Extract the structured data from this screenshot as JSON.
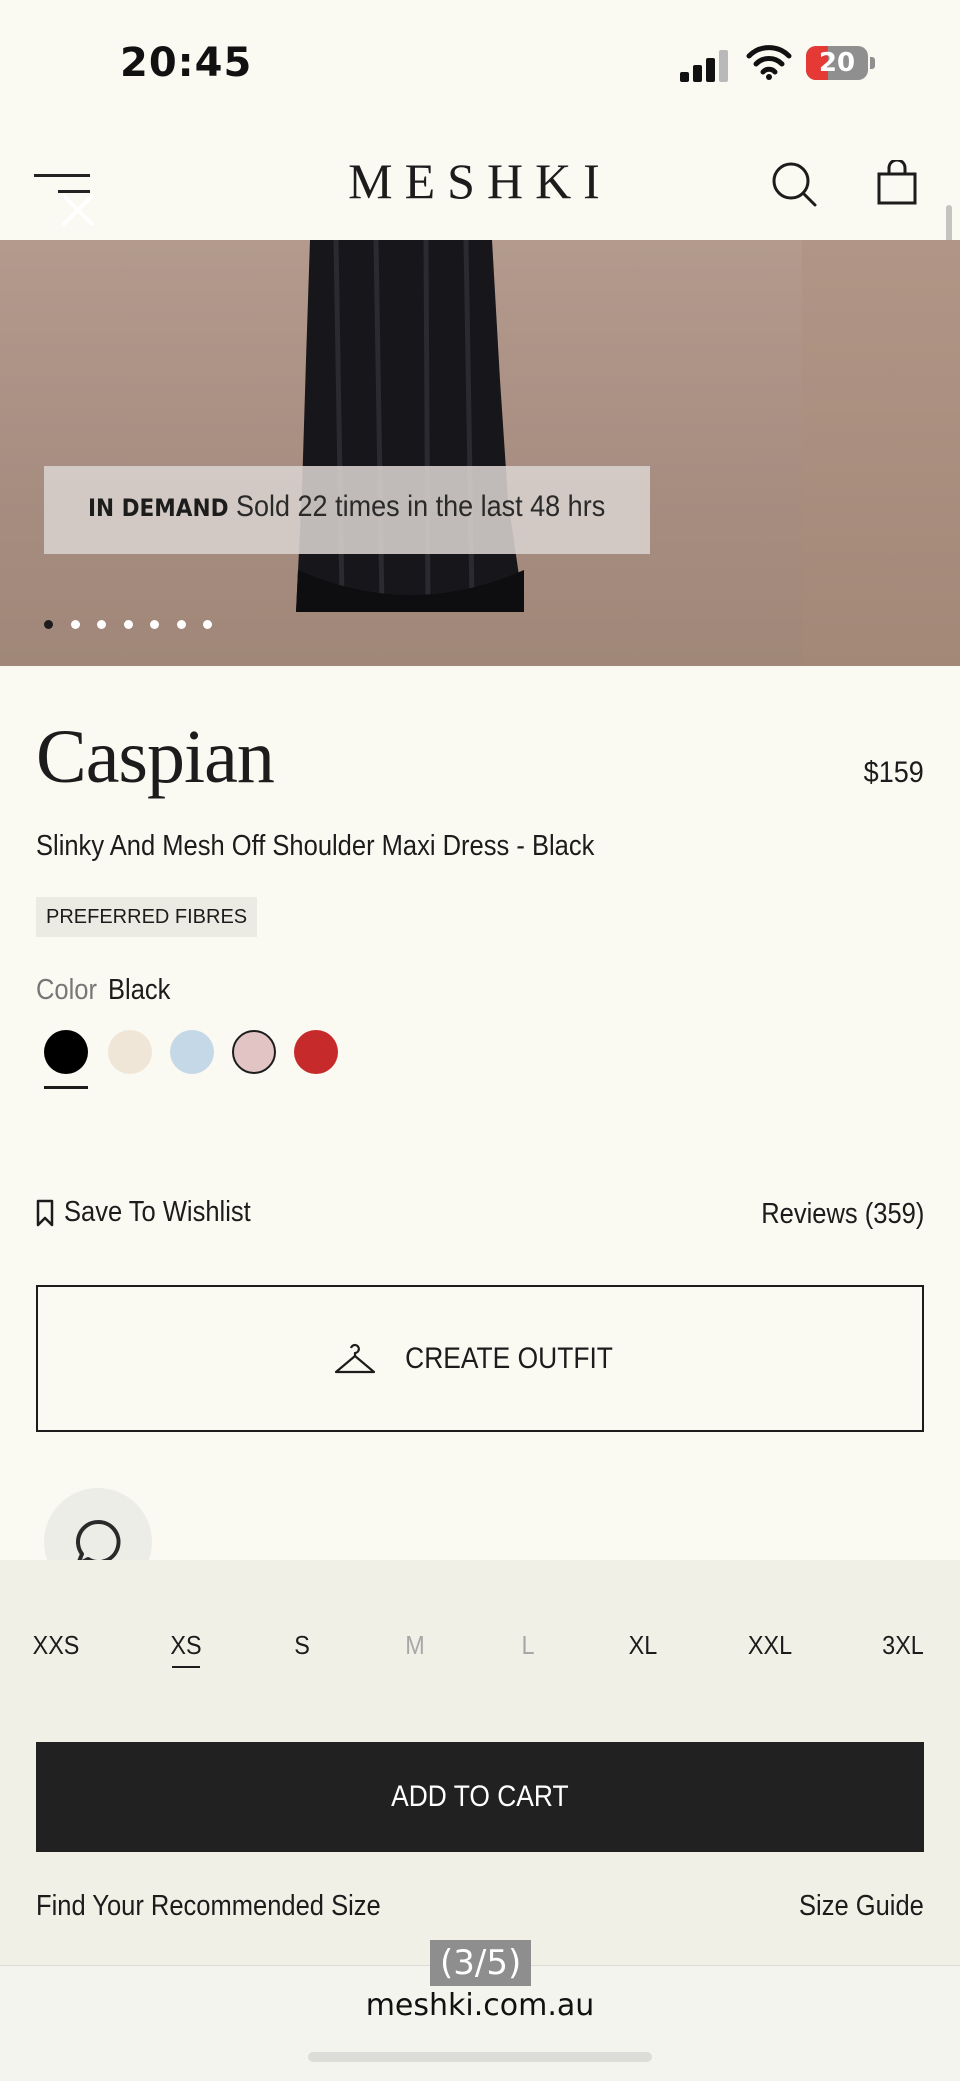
{
  "status_bar": {
    "time": "20:45",
    "battery": "20"
  },
  "header": {
    "logo": "MESHKI"
  },
  "hero": {
    "demand_label": "IN DEMAND",
    "demand_text": "Sold 22 times in the last 48 hrs",
    "image_count": 7,
    "active_image": 1
  },
  "product": {
    "name": "Caspian",
    "price": "$159",
    "subtitle": "Slinky And Mesh Off Shoulder Maxi Dress - Black",
    "badge": "PREFERRED FIBRES",
    "color_label": "Color",
    "color_value": "Black",
    "swatches": [
      {
        "name": "black",
        "hex": "#000000",
        "selected": true
      },
      {
        "name": "cream",
        "hex": "#efe6d8",
        "selected": false
      },
      {
        "name": "light-blue",
        "hex": "#c5d8e8",
        "selected": false
      },
      {
        "name": "blush",
        "hex": "#e2c4c4",
        "selected": false
      },
      {
        "name": "red",
        "hex": "#c72a2a",
        "selected": false
      }
    ]
  },
  "actions": {
    "wishlist": "Save To Wishlist",
    "reviews": "Reviews (359)",
    "create_outfit": "CREATE OUTFIT"
  },
  "sizes": [
    {
      "label": "XXS",
      "available": true,
      "selected": false
    },
    {
      "label": "XS",
      "available": true,
      "selected": true
    },
    {
      "label": "S",
      "available": true,
      "selected": false
    },
    {
      "label": "M",
      "available": false,
      "selected": false
    },
    {
      "label": "L",
      "available": false,
      "selected": false
    },
    {
      "label": "XL",
      "available": true,
      "selected": false
    },
    {
      "label": "XXL",
      "available": true,
      "selected": false
    },
    {
      "label": "3XL",
      "available": true,
      "selected": false
    }
  ],
  "cart": {
    "add_to_cart": "ADD TO CART",
    "recommended_size": "Find Your Recommended Size",
    "size_guide": "Size Guide"
  },
  "browser": {
    "page_counter": "(3/5)",
    "url": "meshki.com.au"
  },
  "colors": {
    "background": "#faf9f2",
    "panel": "#f1f0e6",
    "primary_button": "#212121"
  }
}
